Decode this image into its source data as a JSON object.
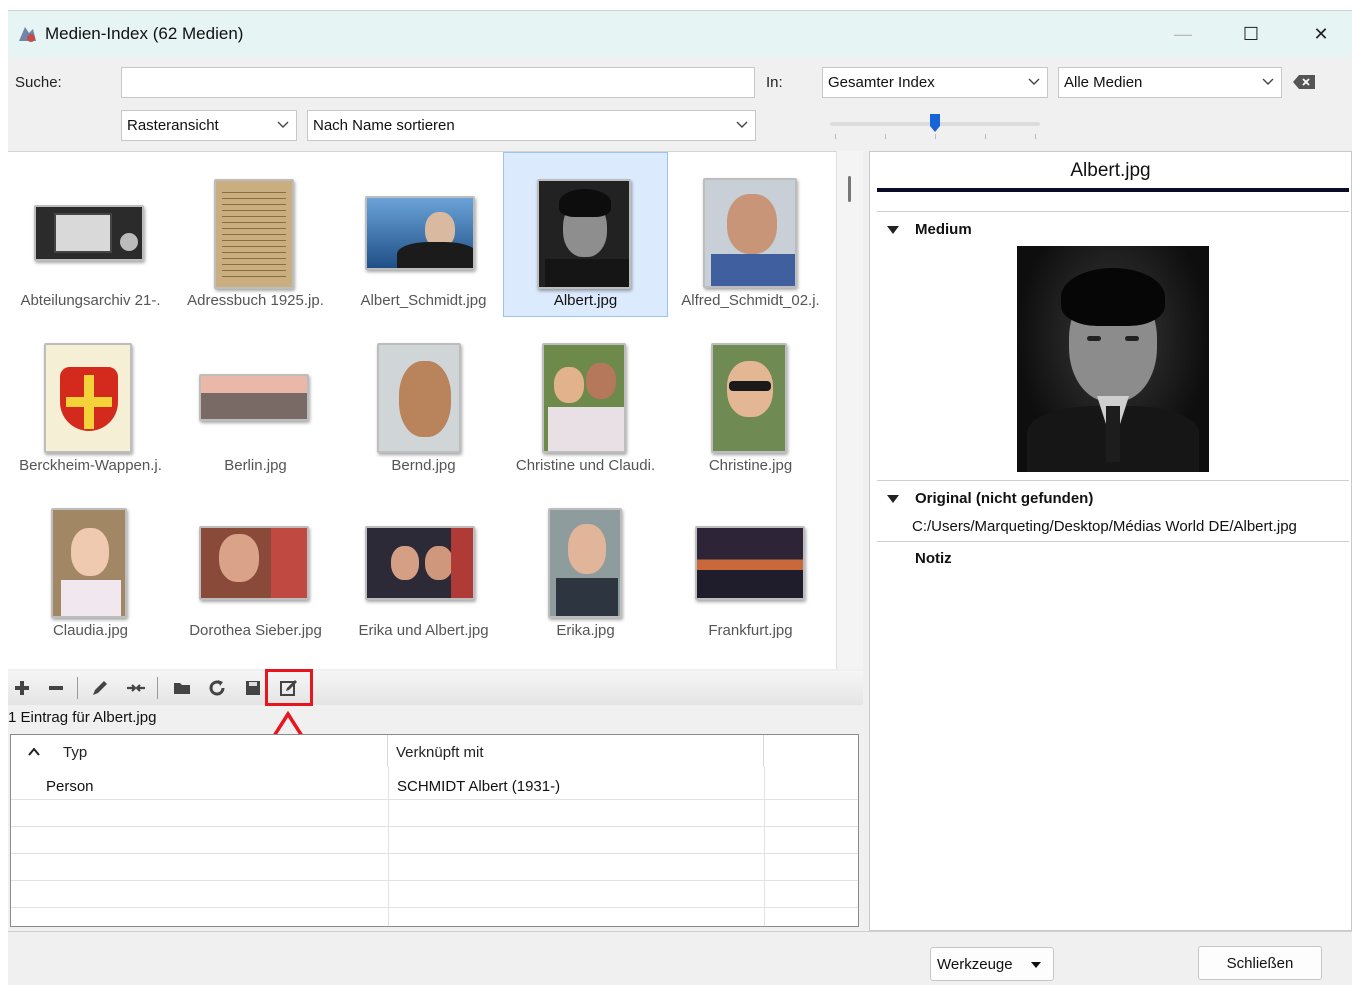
{
  "window": {
    "title": "Medien-Index (62 Medien)",
    "controls": {
      "minimize": "—",
      "maximize": "☐",
      "close": "✕"
    }
  },
  "search": {
    "label": "Suche:",
    "value": "",
    "in_label": "In:",
    "scope_selected": "Gesamter Index",
    "media_filter_selected": "Alle Medien",
    "clear_icon": "backspace-icon"
  },
  "view": {
    "mode_selected": "Rasteransicht",
    "sort_selected": "Nach Name sortieren",
    "zoom_level": 0.5
  },
  "media": [
    {
      "caption": "Abteilungsarchiv 21-.",
      "selected": false
    },
    {
      "caption": "Adressbuch 1925.jp.",
      "selected": false
    },
    {
      "caption": "Albert_Schmidt.jpg",
      "selected": false
    },
    {
      "caption": "Albert.jpg",
      "selected": true
    },
    {
      "caption": "Alfred_Schmidt_02.j.",
      "selected": false
    },
    {
      "caption": "Berckheim-Wappen.j.",
      "selected": false
    },
    {
      "caption": "Berlin.jpg",
      "selected": false
    },
    {
      "caption": "Bernd.jpg",
      "selected": false
    },
    {
      "caption": "Christine und Claudi.",
      "selected": false
    },
    {
      "caption": "Christine.jpg",
      "selected": false
    },
    {
      "caption": "Claudia.jpg",
      "selected": false
    },
    {
      "caption": "Dorothea Sieber.jpg",
      "selected": false
    },
    {
      "caption": "Erika und Albert.jpg",
      "selected": false
    },
    {
      "caption": "Erika.jpg",
      "selected": false
    },
    {
      "caption": "Frankfurt.jpg",
      "selected": false
    }
  ],
  "toolbar_icons": [
    "add-icon",
    "remove-icon",
    "edit-icon",
    "merge-icon",
    "open-folder-icon",
    "refresh-icon",
    "save-icon",
    "edit-properties-icon"
  ],
  "links": {
    "summary": "1 Eintrag für Albert.jpg",
    "columns": [
      "Typ",
      "Verknüpft mit"
    ],
    "rows": [
      {
        "type": "Person",
        "linked": "SCHMIDT Albert (1931-)"
      }
    ]
  },
  "detail": {
    "filename": "Albert.jpg",
    "medium_label": "Medium",
    "original_label": "Original (nicht gefunden)",
    "original_path": "C:/Users/Marqueting/Desktop/Médias World DE/Albert.jpg",
    "note_label": "Notiz"
  },
  "footer": {
    "tools_label": "Werkzeuge",
    "close_label": "Schließen"
  },
  "colors": {
    "selection_bg": "#dbeafd",
    "highlight_annotation": "#e8141e",
    "titlebar_bg": "#e6f4f4"
  }
}
